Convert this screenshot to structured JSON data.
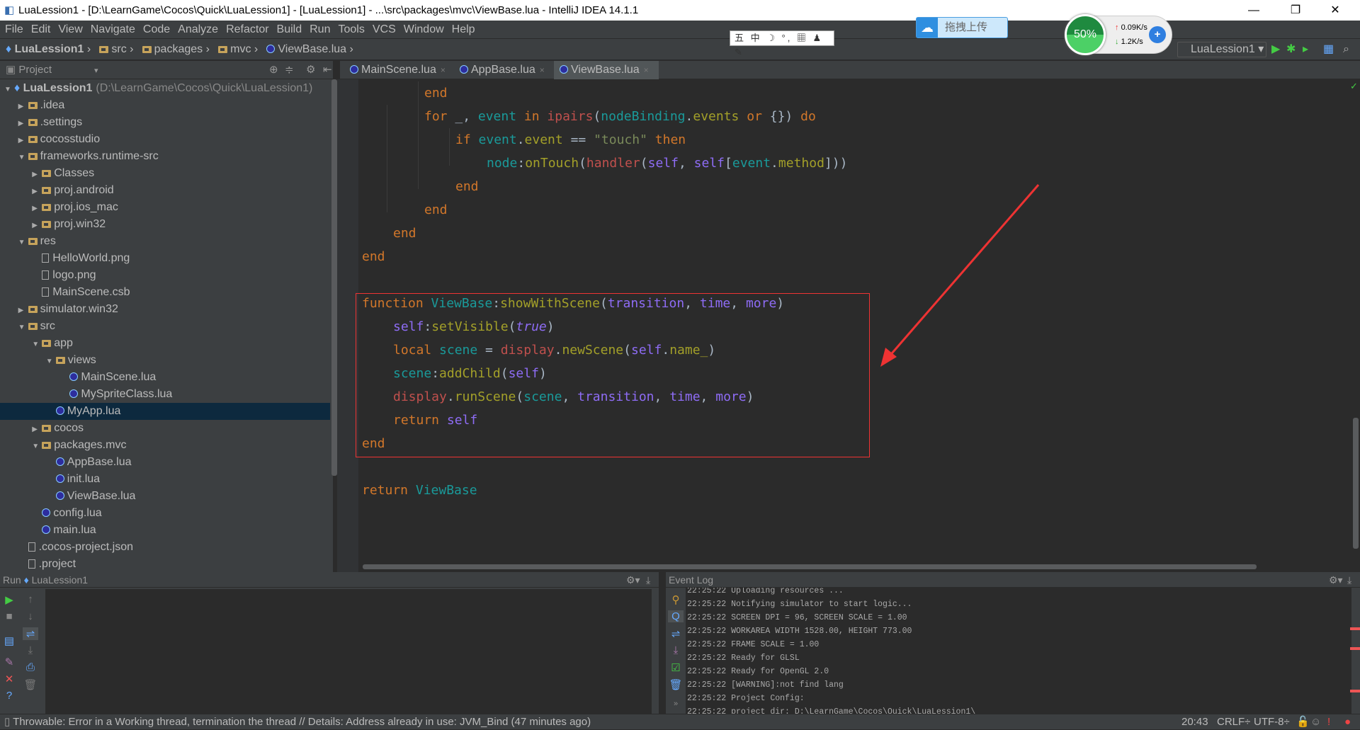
{
  "window": {
    "title": "LuaLession1 - [D:\\LearnGame\\Cocos\\Quick\\LuaLession1] - [LuaLession1] - ...\\src\\packages\\mvc\\ViewBase.lua - IntelliJ IDEA 14.1.1",
    "minimize": "—",
    "restore": "❐",
    "close": "✕"
  },
  "menu": [
    "File",
    "Edit",
    "View",
    "Navigate",
    "Code",
    "Analyze",
    "Refactor",
    "Build",
    "Run",
    "Tools",
    "VCS",
    "Window",
    "Help"
  ],
  "breadcrumb": [
    "LuaLession1",
    "src",
    "packages",
    "mvc",
    "ViewBase.lua"
  ],
  "overlays": {
    "ime": "五 中 ☽ °, ▦ ♟ ✎",
    "upload_label": "拖拽上传",
    "speed_percent": "50%",
    "speed_up": "0.09K/s",
    "speed_down": "1.2K/s"
  },
  "toolbar": {
    "run_config": "LuaLession1"
  },
  "project_panel": {
    "title": "Project"
  },
  "tabs": [
    {
      "label": "MainScene.lua",
      "active": false
    },
    {
      "label": "AppBase.lua",
      "active": false
    },
    {
      "label": "ViewBase.lua",
      "active": true
    }
  ],
  "tree": [
    {
      "label": "LuaLession1",
      "extra": "(D:\\LearnGame\\Cocos\\Quick\\LuaLession1)",
      "level": 0,
      "type": "project",
      "state": "open"
    },
    {
      "label": ".idea",
      "level": 1,
      "type": "folder",
      "state": "closed"
    },
    {
      "label": ".settings",
      "level": 1,
      "type": "folder",
      "state": "closed"
    },
    {
      "label": "cocosstudio",
      "level": 1,
      "type": "folder",
      "state": "closed"
    },
    {
      "label": "frameworks.runtime-src",
      "level": 1,
      "type": "folder",
      "state": "open"
    },
    {
      "label": "Classes",
      "level": 2,
      "type": "folder",
      "state": "closed"
    },
    {
      "label": "proj.android",
      "level": 2,
      "type": "folder",
      "state": "closed"
    },
    {
      "label": "proj.ios_mac",
      "level": 2,
      "type": "folder",
      "state": "closed"
    },
    {
      "label": "proj.win32",
      "level": 2,
      "type": "folder",
      "state": "closed"
    },
    {
      "label": "res",
      "level": 1,
      "type": "folder",
      "state": "open"
    },
    {
      "label": "HelloWorld.png",
      "level": 2,
      "type": "file"
    },
    {
      "label": "logo.png",
      "level": 2,
      "type": "file"
    },
    {
      "label": "MainScene.csb",
      "level": 2,
      "type": "file"
    },
    {
      "label": "simulator.win32",
      "level": 1,
      "type": "folder",
      "state": "closed"
    },
    {
      "label": "src",
      "level": 1,
      "type": "folder",
      "state": "open"
    },
    {
      "label": "app",
      "level": 2,
      "type": "folder",
      "state": "open"
    },
    {
      "label": "views",
      "level": 3,
      "type": "folder",
      "state": "open"
    },
    {
      "label": "MainScene.lua",
      "level": 4,
      "type": "lua"
    },
    {
      "label": "MySpriteClass.lua",
      "level": 4,
      "type": "lua"
    },
    {
      "label": "MyApp.lua",
      "level": 3,
      "type": "lua",
      "selected": true
    },
    {
      "label": "cocos",
      "level": 2,
      "type": "folder",
      "state": "closed"
    },
    {
      "label": "packages.mvc",
      "level": 2,
      "type": "folder",
      "state": "open"
    },
    {
      "label": "AppBase.lua",
      "level": 3,
      "type": "lua"
    },
    {
      "label": "init.lua",
      "level": 3,
      "type": "lua"
    },
    {
      "label": "ViewBase.lua",
      "level": 3,
      "type": "lua"
    },
    {
      "label": "config.lua",
      "level": 2,
      "type": "lua"
    },
    {
      "label": "main.lua",
      "level": 2,
      "type": "lua"
    },
    {
      "label": ".cocos-project.json",
      "level": 1,
      "type": "file"
    },
    {
      "label": ".project",
      "level": 1,
      "type": "file"
    }
  ],
  "code": [
    {
      "indent": 2,
      "tokens": [
        [
          "end",
          "kw"
        ]
      ]
    },
    {
      "indent": 2,
      "tokens": [
        [
          "for",
          "kw"
        ],
        [
          " _, ",
          "pl"
        ],
        [
          "event",
          "id"
        ],
        [
          " in ",
          "kw"
        ],
        [
          "ipairs",
          "fn"
        ],
        [
          "(",
          "pl"
        ],
        [
          "nodeBinding",
          "id"
        ],
        [
          ".",
          "pl"
        ],
        [
          "events",
          "fd"
        ],
        [
          " or ",
          "kw"
        ],
        [
          "{}) ",
          "pl"
        ],
        [
          "do",
          "kw"
        ]
      ]
    },
    {
      "indent": 3,
      "tokens": [
        [
          "if ",
          "kw"
        ],
        [
          "event",
          "id"
        ],
        [
          ".",
          "pl"
        ],
        [
          "event",
          "fd"
        ],
        [
          " == ",
          "pl"
        ],
        [
          "\"touch\"",
          "st"
        ],
        [
          " then",
          "kw"
        ]
      ]
    },
    {
      "indent": 4,
      "tokens": [
        [
          "node",
          "id"
        ],
        [
          ":",
          "pl"
        ],
        [
          "onTouch",
          "fd"
        ],
        [
          "(",
          "pl"
        ],
        [
          "handler",
          "fn"
        ],
        [
          "(",
          "pl"
        ],
        [
          "self",
          "sf"
        ],
        [
          ", ",
          "pl"
        ],
        [
          "self",
          "sf"
        ],
        [
          "[",
          "pl"
        ],
        [
          "event",
          "id"
        ],
        [
          ".",
          "pl"
        ],
        [
          "method",
          "fd"
        ],
        [
          "]))",
          "pl"
        ]
      ]
    },
    {
      "indent": 3,
      "tokens": [
        [
          "end",
          "kw"
        ]
      ]
    },
    {
      "indent": 2,
      "tokens": [
        [
          "end",
          "kw"
        ]
      ]
    },
    {
      "indent": 1,
      "tokens": [
        [
          "end",
          "kw"
        ]
      ]
    },
    {
      "indent": 0,
      "tokens": [
        [
          "end",
          "kw"
        ]
      ]
    },
    {
      "indent": 0,
      "tokens": []
    },
    {
      "indent": 0,
      "tokens": [
        [
          "function ",
          "kw"
        ],
        [
          "ViewBase",
          "id"
        ],
        [
          ":",
          "pl"
        ],
        [
          "showWithScene",
          "fd"
        ],
        [
          "(",
          "pl"
        ],
        [
          "transition",
          "sf"
        ],
        [
          ", ",
          "pl"
        ],
        [
          "time",
          "sf"
        ],
        [
          ", ",
          "pl"
        ],
        [
          "more",
          "sf"
        ],
        [
          ")",
          "pl"
        ]
      ]
    },
    {
      "indent": 1,
      "tokens": [
        [
          "self",
          "sf"
        ],
        [
          ":",
          "pl"
        ],
        [
          "setVisible",
          "fd"
        ],
        [
          "(",
          "pl"
        ],
        [
          "true",
          "it"
        ],
        [
          ")",
          "pl"
        ]
      ]
    },
    {
      "indent": 1,
      "tokens": [
        [
          "local ",
          "kw"
        ],
        [
          "scene",
          "id"
        ],
        [
          " = ",
          "pl"
        ],
        [
          "display",
          "fn"
        ],
        [
          ".",
          "pl"
        ],
        [
          "newScene",
          "fd"
        ],
        [
          "(",
          "pl"
        ],
        [
          "self",
          "sf"
        ],
        [
          ".",
          "pl"
        ],
        [
          "name_",
          "fd"
        ],
        [
          ")",
          "pl"
        ]
      ]
    },
    {
      "indent": 1,
      "tokens": [
        [
          "scene",
          "id"
        ],
        [
          ":",
          "pl"
        ],
        [
          "addChild",
          "fd"
        ],
        [
          "(",
          "pl"
        ],
        [
          "self",
          "sf"
        ],
        [
          ")",
          "pl"
        ]
      ]
    },
    {
      "indent": 1,
      "tokens": [
        [
          "display",
          "fn"
        ],
        [
          ".",
          "pl"
        ],
        [
          "runScene",
          "fd"
        ],
        [
          "(",
          "pl"
        ],
        [
          "scene",
          "id"
        ],
        [
          ", ",
          "pl"
        ],
        [
          "transition",
          "sf"
        ],
        [
          ", ",
          "pl"
        ],
        [
          "time",
          "sf"
        ],
        [
          ", ",
          "pl"
        ],
        [
          "more",
          "sf"
        ],
        [
          ")",
          "pl"
        ]
      ]
    },
    {
      "indent": 1,
      "tokens": [
        [
          "return ",
          "kw"
        ],
        [
          "self",
          "sf"
        ]
      ]
    },
    {
      "indent": 0,
      "tokens": [
        [
          "end",
          "kw"
        ]
      ]
    },
    {
      "indent": 0,
      "tokens": []
    },
    {
      "indent": 0,
      "tokens": [
        [
          "return ",
          "kw"
        ],
        [
          "ViewBase",
          "id"
        ]
      ]
    }
  ],
  "run_panel": {
    "title": "Run",
    "config": "LuaLession1"
  },
  "event_log": {
    "title": "Event Log",
    "lines": [
      "22:25:22 Uploading resources ...",
      "22:25:22 Notifying simulator to start logic...",
      "22:25:22 SCREEN DPI = 96, SCREEN SCALE = 1.00",
      "22:25:22 WORKAREA WIDTH 1528.00, HEIGHT 773.00",
      "22:25:22 FRAME SCALE = 1.00",
      "22:25:22 Ready for GLSL",
      "22:25:22 Ready for OpenGL 2.0",
      "22:25:22 [WARNING]:not find lang",
      "22:25:22 Project Config:",
      "22:25:22 project dir: D:\\LearnGame\\Cocos\\Quick\\LuaLession1\\"
    ]
  },
  "status": {
    "message": "Throwable: Error in a Working thread, termination the thread // Details: Address already in use: JVM_Bind (47 minutes ago)",
    "position": "20:43",
    "line_sep": "CRLF",
    "encoding": "UTF-8"
  },
  "colors": {
    "keyword": "#d2772a",
    "identifier": "#1a9a9a",
    "field": "#a3a029",
    "function": "#c0504d",
    "self": "#8e6cf5",
    "string": "#7a8a5a",
    "annotation": "#e33333",
    "selection": "#0d293e"
  }
}
